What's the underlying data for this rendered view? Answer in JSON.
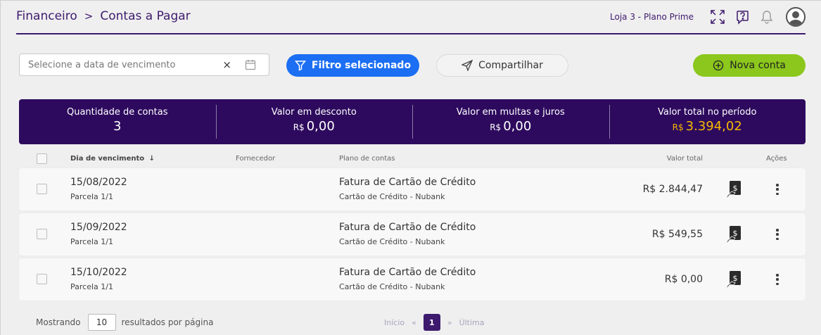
{
  "header": {
    "breadcrumb": [
      "Financeiro",
      "Contas a Pagar"
    ],
    "breadcrumb_separator": ">",
    "store_label": "Loja 3 - Plano Prime",
    "icons": [
      "fullscreen-icon",
      "help-chat-icon",
      "bell-icon",
      "user-avatar-icon"
    ]
  },
  "toolbar": {
    "date_placeholder": "Selecione a data de vencimento",
    "clear_symbol": "×",
    "filter_label": "Filtro selecionado",
    "share_label": "Compartilhar",
    "new_label": "Nova conta"
  },
  "summary": [
    {
      "label": "Quantidade de contas",
      "currency": "",
      "value": "3"
    },
    {
      "label": "Valor em desconto",
      "currency": "R$",
      "value": "0,00"
    },
    {
      "label": "Valor em multas e juros",
      "currency": "R$",
      "value": "0,00"
    },
    {
      "label": "Valor total no período",
      "currency": "R$",
      "value": "3.394,02"
    }
  ],
  "table": {
    "columns": {
      "due": "Dia de vencimento",
      "sort_arrow": "↓",
      "supplier": "Fornecedor",
      "plan": "Plano de contas",
      "total": "Valor total",
      "actions": "Ações"
    },
    "rows": [
      {
        "date": "15/08/2022",
        "installment": "Parcela 1/1",
        "plan": "Fatura de Cartão de Crédito",
        "subplan": "Cartão de Crédito - Nubank",
        "value": "R$ 2.844,47"
      },
      {
        "date": "15/09/2022",
        "installment": "Parcela 1/1",
        "plan": "Fatura de Cartão de Crédito",
        "subplan": "Cartão de Crédito - Nubank",
        "value": "R$ 549,55"
      },
      {
        "date": "15/10/2022",
        "installment": "Parcela 1/1",
        "plan": "Fatura de Cartão de Crédito",
        "subplan": "Cartão de Crédito - Nubank",
        "value": "R$ 0,00"
      }
    ]
  },
  "footer": {
    "showing_label": "Mostrando",
    "per_page_value": "10",
    "per_page_suffix": "resultados por página",
    "first_label": "Início",
    "prev_symbol": "«",
    "current_page": "1",
    "next_symbol": "»",
    "last_label": "Última"
  },
  "colors": {
    "brand_purple": "#2d0a5e",
    "primary_blue": "#1c6ef2",
    "new_green": "#8bc71c",
    "total_yellow": "#f5b800"
  }
}
